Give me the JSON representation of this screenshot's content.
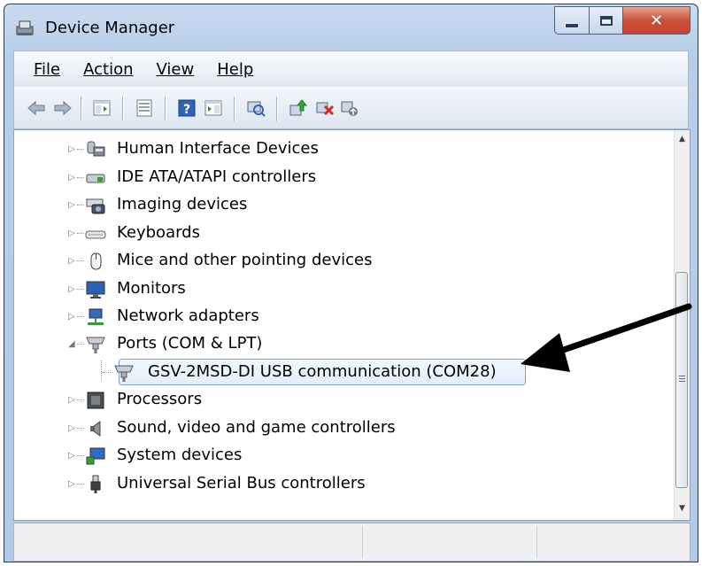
{
  "window": {
    "title": "Device Manager"
  },
  "menu": [
    {
      "label": "File"
    },
    {
      "label": "Action"
    },
    {
      "label": "View"
    },
    {
      "label": "Help"
    }
  ],
  "tree": {
    "items": [
      {
        "label": "Human Interface Devices",
        "icon": "hid-icon",
        "expanded": false
      },
      {
        "label": "IDE ATA/ATAPI controllers",
        "icon": "ide-controller-icon",
        "expanded": false
      },
      {
        "label": "Imaging devices",
        "icon": "camera-icon",
        "expanded": false
      },
      {
        "label": "Keyboards",
        "icon": "keyboard-icon",
        "expanded": false
      },
      {
        "label": "Mice and other pointing devices",
        "icon": "mouse-icon",
        "expanded": false
      },
      {
        "label": "Monitors",
        "icon": "monitor-icon",
        "expanded": false
      },
      {
        "label": "Network adapters",
        "icon": "network-icon",
        "expanded": false
      },
      {
        "label": "Ports (COM & LPT)",
        "icon": "port-icon",
        "expanded": true
      },
      {
        "label": "GSV-2MSD-DI USB communication (COM28)",
        "icon": "port-icon",
        "child": true,
        "selected": true
      },
      {
        "label": "Processors",
        "icon": "processor-icon",
        "expanded": false
      },
      {
        "label": "Sound, video and game controllers",
        "icon": "speaker-icon",
        "expanded": false
      },
      {
        "label": "System devices",
        "icon": "system-icon",
        "expanded": false
      },
      {
        "label": "Universal Serial Bus controllers",
        "icon": "usb-icon",
        "expanded": false
      }
    ]
  },
  "colors": {
    "arrow": "#000000",
    "selection_border": "#7da2ce",
    "close_button": "#c74430"
  }
}
